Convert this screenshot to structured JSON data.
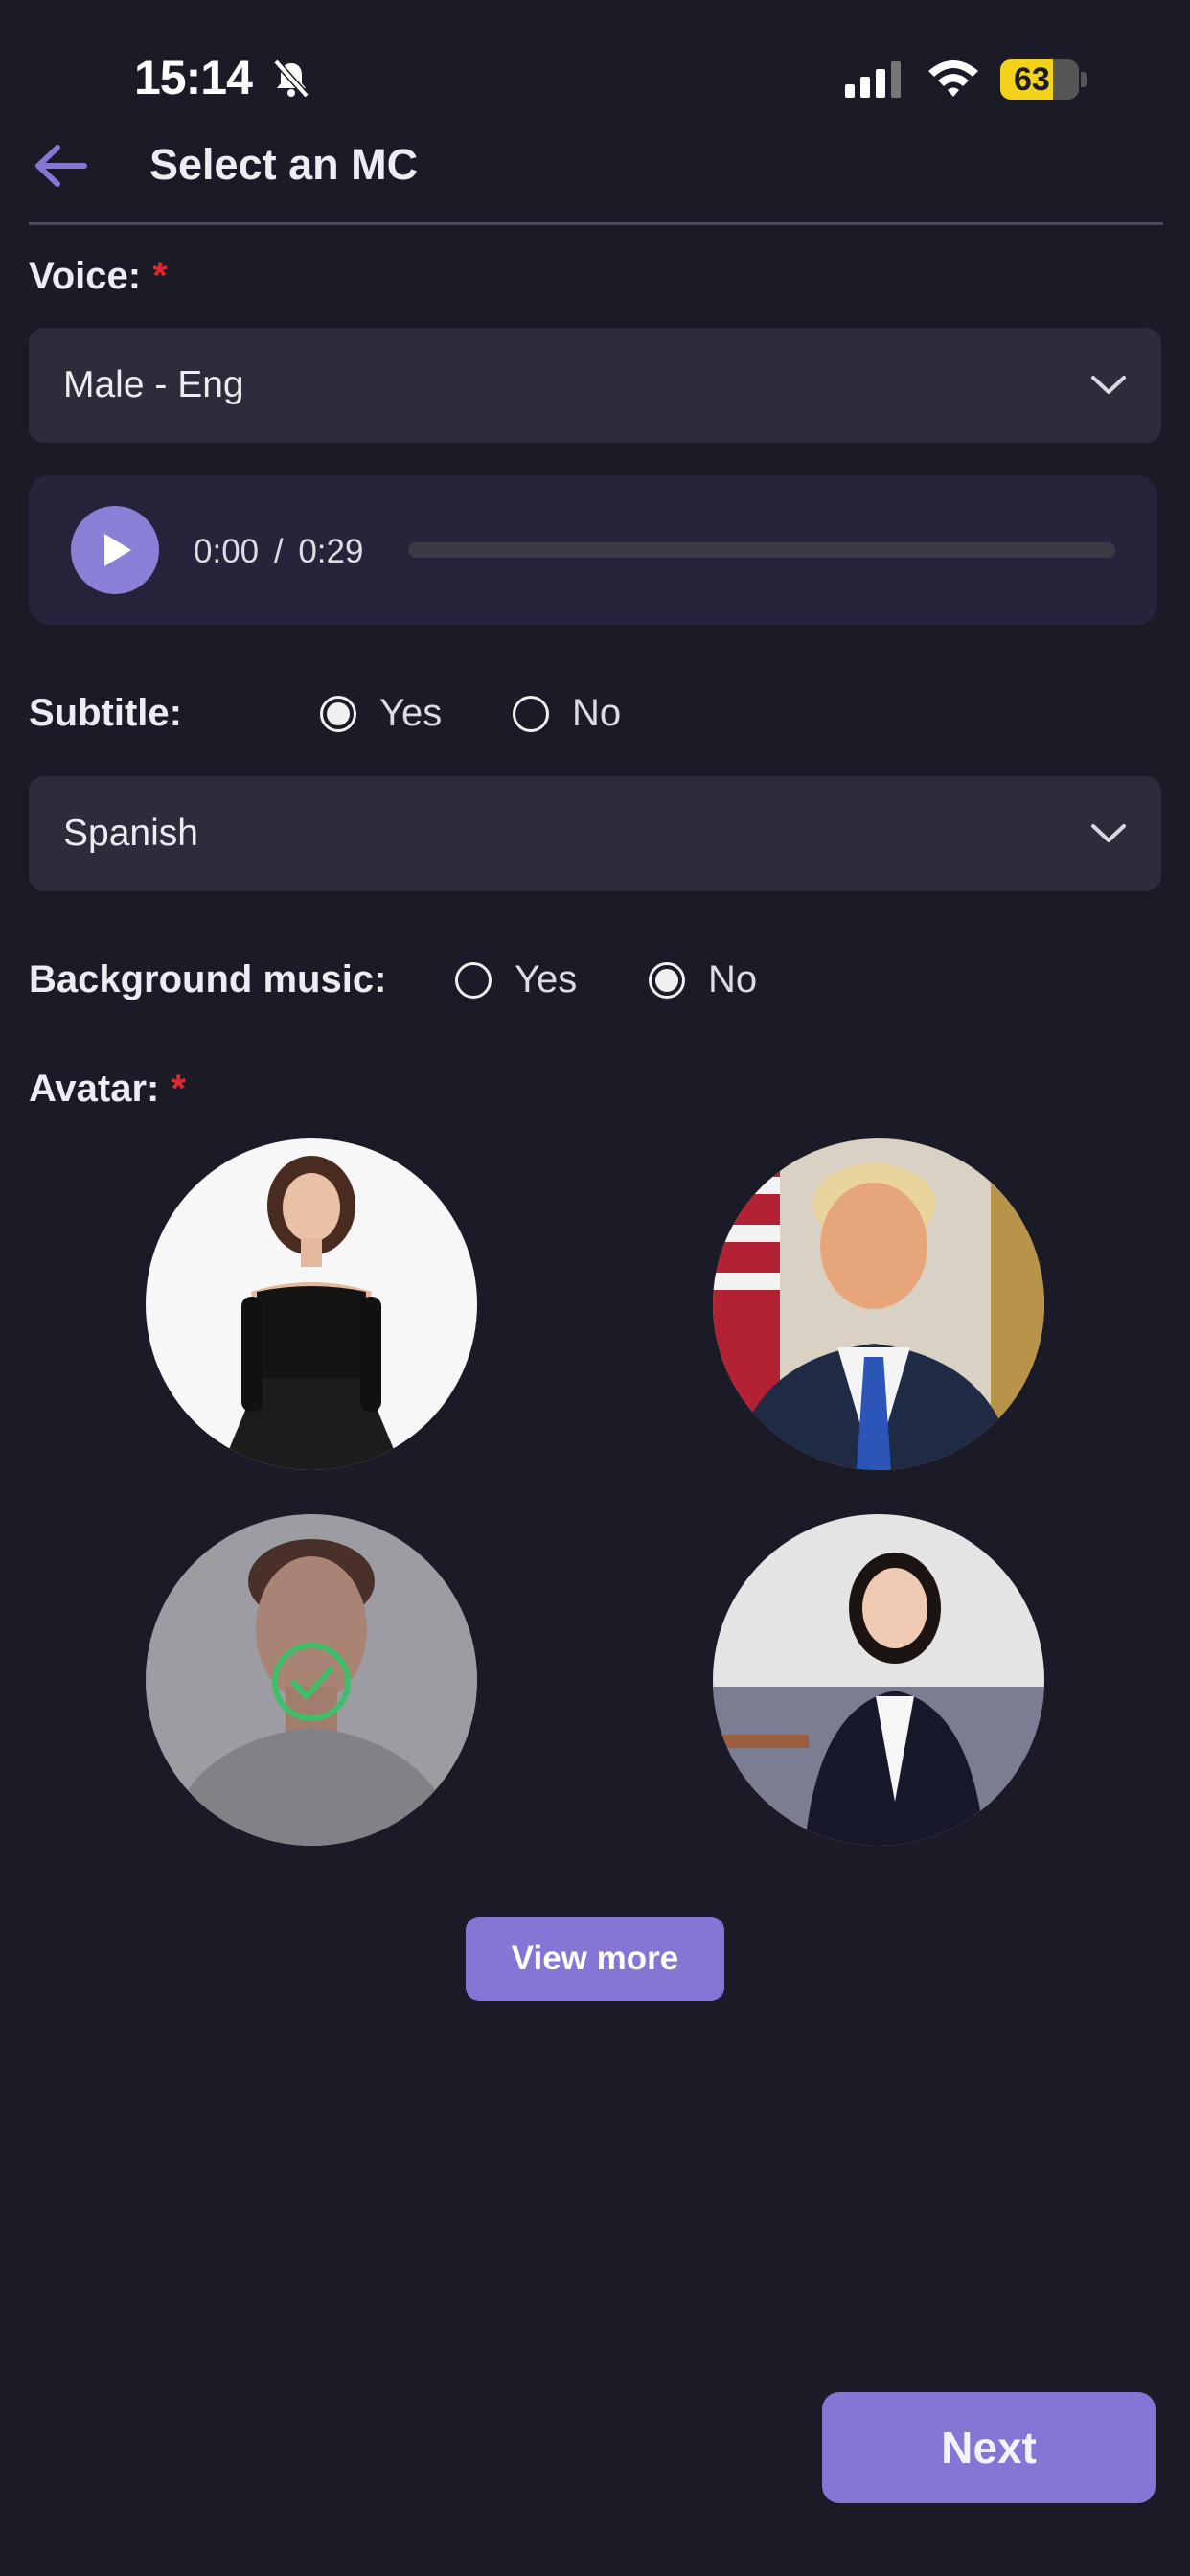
{
  "status": {
    "time": "15:14",
    "battery": "63"
  },
  "header": {
    "title": "Select an MC"
  },
  "voice": {
    "label": "Voice:",
    "required": "*",
    "selected": "Male - Eng"
  },
  "player": {
    "current_time": "0:00",
    "separator": "/",
    "duration": "0:29",
    "progress": 0
  },
  "subtitle": {
    "label": "Subtitle:",
    "yes": "Yes",
    "no": "No",
    "selected": "Yes",
    "language": "Spanish"
  },
  "background_music": {
    "label": "Background music:",
    "yes": "Yes",
    "no": "No",
    "selected": "No"
  },
  "avatar": {
    "label": "Avatar:",
    "required": "*",
    "items": [
      {
        "name": "woman-black-dress"
      },
      {
        "name": "man-suit-flag"
      },
      {
        "name": "man-grey-shirt",
        "selected": true
      },
      {
        "name": "woman-business-suit"
      }
    ]
  },
  "buttons": {
    "view_more": "View more",
    "next": "Next"
  },
  "colors": {
    "background": "#1b1a27",
    "accent": "#8476d4",
    "required": "#e0282f",
    "check": "#3fbf6a"
  }
}
